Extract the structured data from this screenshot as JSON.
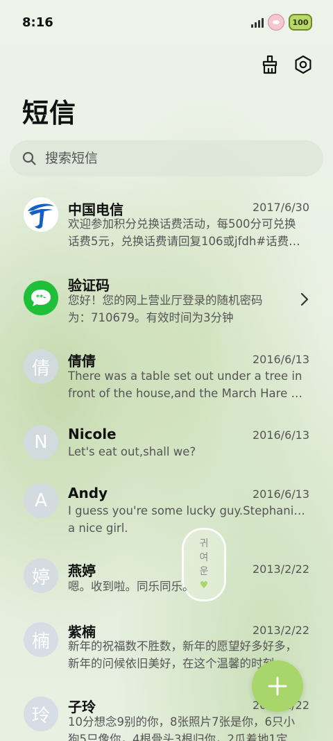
{
  "status": {
    "time": "8:16",
    "battery": "100"
  },
  "header": {
    "title": "短信"
  },
  "search": {
    "placeholder": "搜索短信"
  },
  "accent": {
    "fab": "#a8d66a",
    "verify_icon": "#1fbf3a",
    "telecom_blue": "#1560c8"
  },
  "conversations": [
    {
      "name": "中国电信",
      "date": "2017/6/30",
      "avatar": "telecom-logo",
      "line1": "欢迎参加积分兑换话费活动，每500分可兑换",
      "line2": "话费5元，兑换话费请回复106或jfdh#话费…"
    },
    {
      "name": "验证码",
      "date": "",
      "avatar": "message-bubble-icon",
      "line1": "您好！您的网上营业厅登录的随机密码",
      "line2": "为：710679。有效时间为3分钟"
    },
    {
      "name": "倩倩",
      "date": "2016/6/13",
      "avatar_letter": "倩",
      "line1": "There was a table set out under a tree in",
      "line2": "front of the house,and the March Hare an…"
    },
    {
      "name": "Nicole",
      "date": "2016/6/13",
      "avatar_letter": "N",
      "line1": "Let's eat out,shall we?",
      "line2": ""
    },
    {
      "name": "Andy",
      "date": "2016/6/13",
      "avatar_letter": "A",
      "line1": "I guess you're some lucky guy.Stephanie is",
      "line2": "a nice girl."
    },
    {
      "name": "燕婷",
      "date": "2013/2/22",
      "avatar_letter": "婷",
      "line1": "嗯。收到啦。同乐同乐。",
      "line2": ""
    },
    {
      "name": "紫楠",
      "date": "2013/2/22",
      "avatar_letter": "楠",
      "line1": "新年的祝福数不胜数，新年的愿望好多好多，",
      "line2": "新年的问候依旧美好，在这个温馨的时刻…"
    },
    {
      "name": "子玲",
      "date": "2013/2/22",
      "avatar_letter": "玲",
      "line1": "10分想念9别的你，8张照片7张是你，6只小",
      "line2": "狗5只像你，4根骨头3根归你，2瓜着地1定…"
    }
  ],
  "decoration": {
    "badge_text": [
      "귀",
      "여",
      "운"
    ]
  }
}
